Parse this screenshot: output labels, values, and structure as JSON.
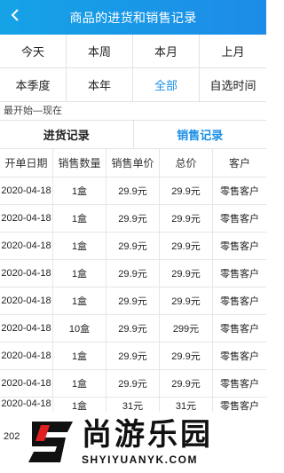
{
  "header": {
    "title": "商品的进货和销售记录",
    "back_icon": "chevron-left-icon"
  },
  "periods": [
    {
      "label": "今天",
      "active": false
    },
    {
      "label": "本周",
      "active": false
    },
    {
      "label": "本月",
      "active": false
    },
    {
      "label": "上月",
      "active": false
    },
    {
      "label": "本季度",
      "active": false
    },
    {
      "label": "本年",
      "active": false
    },
    {
      "label": "全部",
      "active": true
    },
    {
      "label": "自选时间",
      "active": false
    }
  ],
  "range_text": "最开始—现在",
  "tabs": [
    {
      "label": "进货记录",
      "active": false
    },
    {
      "label": "销售记录",
      "active": true
    }
  ],
  "table": {
    "columns": [
      "开单日期",
      "销售数量",
      "销售单价",
      "总价",
      "客户"
    ],
    "rows": [
      [
        "2020-04-18",
        "1盒",
        "29.9元",
        "29.9元",
        "零售客户"
      ],
      [
        "2020-04-18",
        "1盒",
        "29.9元",
        "29.9元",
        "零售客户"
      ],
      [
        "2020-04-18",
        "1盒",
        "29.9元",
        "29.9元",
        "零售客户"
      ],
      [
        "2020-04-18",
        "1盒",
        "29.9元",
        "29.9元",
        "零售客户"
      ],
      [
        "2020-04-18",
        "1盒",
        "29.9元",
        "29.9元",
        "零售客户"
      ],
      [
        "2020-04-18",
        "10盒",
        "29.9元",
        "299元",
        "零售客户"
      ],
      [
        "2020-04-18",
        "1盒",
        "29.9元",
        "29.9元",
        "零售客户"
      ],
      [
        "2020-04-18",
        "1盒",
        "29.9元",
        "29.9元",
        "零售客户"
      ],
      [
        "2020-04-18",
        "1盒",
        "31元",
        "31元",
        "零售客户"
      ]
    ],
    "partial_row_text": "202"
  },
  "watermark": {
    "cn": "尚游乐园",
    "en": "SHYIYUANYK.COM",
    "logo_icon": "s-logo-icon",
    "colors": {
      "logo_dark": "#111111",
      "logo_red": "#e02020"
    }
  },
  "colors": {
    "header_start": "#15a3e6",
    "header_end": "#1d8ce8",
    "accent": "#1a8fe6"
  }
}
